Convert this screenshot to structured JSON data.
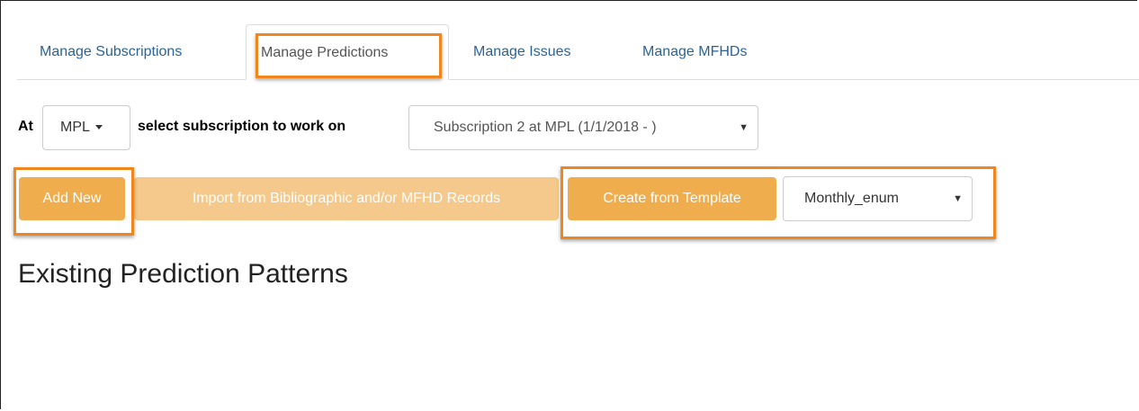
{
  "tabs": {
    "subscriptions": "Manage Subscriptions",
    "predictions": "Manage Predictions",
    "issues": "Manage Issues",
    "mfhds": "Manage MFHDs"
  },
  "subscription_row": {
    "at_label": "At",
    "library": "MPL",
    "select_label": "select subscription to work on",
    "subscription": "Subscription 2 at MPL (1/1/2018 - )"
  },
  "actions": {
    "add_new": "Add New",
    "import": "Import from Bibliographic and/or MFHD Records",
    "create_from_template": "Create from Template",
    "template": "Monthly_enum"
  },
  "heading": "Existing Prediction Patterns",
  "colors": {
    "warning": "#f0ad4e",
    "highlight": "#f0861e",
    "link": "#2a6496"
  }
}
